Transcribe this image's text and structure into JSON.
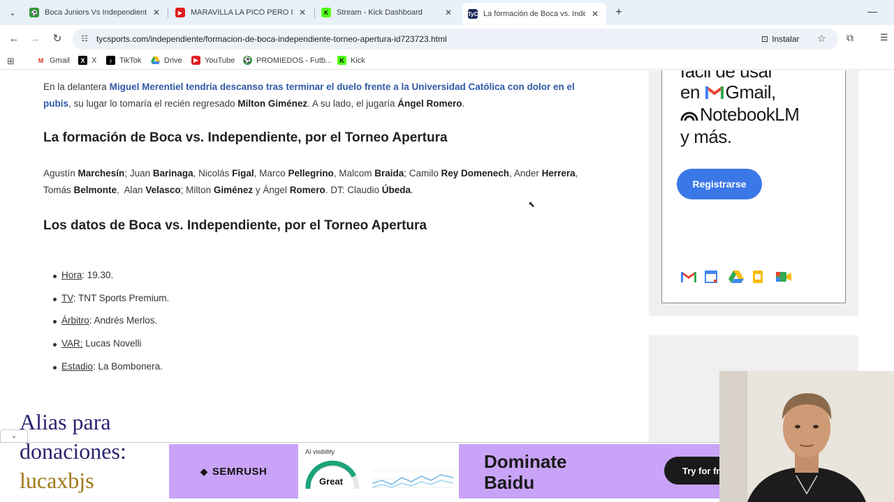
{
  "browser": {
    "tabs": [
      {
        "title": "Boca Juniors Vs Independiente",
        "favicon_color": "#2e9b3a",
        "active": false
      },
      {
        "title": "MARAVILLA LA PICÓ PERO LO",
        "favicon_color": "#e02020",
        "active": false
      },
      {
        "title": "Stream - Kick Dashboard",
        "favicon_color": "#53fc18",
        "active": false
      },
      {
        "title": "La formación de Boca vs. Indep",
        "favicon_color": "#1b2a5c",
        "active": true
      }
    ],
    "url": "tycsports.com/independiente/formacion-de-boca-independiente-torneo-apertura-id723723.html",
    "install_label": "Instalar",
    "bookmarks": [
      {
        "label": "Gmail",
        "icon": "gmail-icon"
      },
      {
        "label": "X",
        "icon": "x-icon"
      },
      {
        "label": "TikTok",
        "icon": "tiktok-icon"
      },
      {
        "label": "Drive",
        "icon": "drive-icon"
      },
      {
        "label": "YouTube",
        "icon": "youtube-icon"
      },
      {
        "label": "PROMIEDOS - Futb...",
        "icon": "promiedos-icon"
      },
      {
        "label": "Kick",
        "icon": "kick-icon"
      }
    ]
  },
  "article": {
    "p1": {
      "t1": "En la delantera ",
      "link": "Miguel Merentiel tendría descanso tras terminar el duelo frente a la Universidad Católica con dolor en el pubis",
      "t2": ", su lugar lo tomaría el recién regresado ",
      "b1": "Milton Giménez",
      "t3": ". A su lado, el jugaría ",
      "b2": "Ángel Romero",
      "t4": "."
    },
    "heading_formacion": "La formación de Boca vs. Independiente, por el Torneo Apertura",
    "lineup": [
      {
        "first": "Agustín ",
        "last": "Marchesín",
        "sep": "; Juan "
      },
      {
        "first": "",
        "last": "Barinaga",
        "sep": ", Nicolás "
      },
      {
        "first": "",
        "last": "Figal",
        "sep": ", Marco "
      },
      {
        "first": "",
        "last": "Pellegrino",
        "sep": ", Malcom "
      },
      {
        "first": "",
        "last": "Braida",
        "sep": "; Camilo "
      },
      {
        "first": "",
        "last": "Rey Domenech",
        "sep": ", Ander "
      },
      {
        "first": "",
        "last": "Herrera",
        "sep": ", Tomás "
      },
      {
        "first": "",
        "last": "Belmonte",
        "sep": ",  Alan "
      },
      {
        "first": "",
        "last": "Velasco",
        "sep": "; Milton "
      },
      {
        "first": "",
        "last": "Giménez",
        "sep": " y Ángel "
      },
      {
        "first": "",
        "last": "Romero",
        "sep": ". DT: Claudio "
      },
      {
        "first": "",
        "last": "Úbeda",
        "sep": "."
      }
    ],
    "heading_datos": "Los datos de Boca vs. Independiente, por el Torneo Apertura",
    "datos": [
      {
        "key": "Hora",
        "value": ": 19.30."
      },
      {
        "key": "TV",
        "value": ": TNT Sports Premium."
      },
      {
        "key": "Árbitro",
        "value": ": Andrés Merlos."
      },
      {
        "key": "VAR:",
        "value": " Lucas Novelli"
      },
      {
        "key": "Estadio",
        "value": ": La Bombonera."
      }
    ]
  },
  "side_ad": {
    "line1": "fácil de usar",
    "line2_pre": "en ",
    "line2_post": "Gmail,",
    "line3": "NotebookLM",
    "line4": "y más.",
    "button": "Registrarse"
  },
  "bottom_ad": {
    "brand": "SEMRUSH",
    "ai_label": "AI visibility",
    "ai_score": "Great",
    "headline_1": "Dominate",
    "headline_2": "Baidu",
    "cta": "Try for fr"
  },
  "overlay": {
    "line1": "Alias para",
    "line2": "donaciones:",
    "line3": "lucaxbjs"
  },
  "colors": {
    "link": "#2f5aa8",
    "ad_button": "#3b78e7",
    "semrush_bg": "#c9a3f7"
  }
}
